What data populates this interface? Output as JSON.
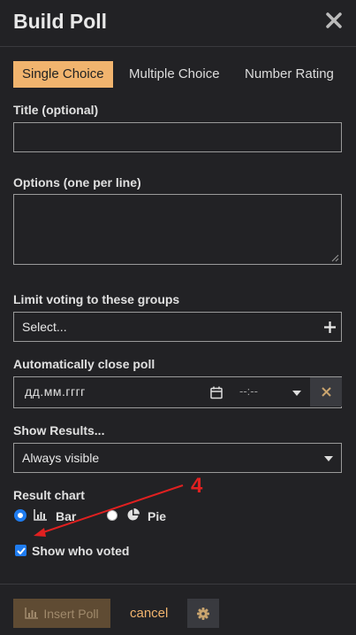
{
  "header": {
    "title": "Build Poll"
  },
  "tabs": [
    "Single Choice",
    "Multiple Choice",
    "Number Rating"
  ],
  "title_field": {
    "label": "Title (optional)",
    "value": ""
  },
  "options_field": {
    "label": "Options (one per line)",
    "value": ""
  },
  "groups_field": {
    "label": "Limit voting to these groups",
    "value": "Select..."
  },
  "close_field": {
    "label": "Automatically close poll",
    "date": "дд.мм.гггг",
    "time": "--:--"
  },
  "results_field": {
    "label": "Show Results...",
    "value": "Always visible"
  },
  "chart_field": {
    "label": "Result chart",
    "options": [
      "Bar",
      "Pie"
    ],
    "selected": "Bar"
  },
  "show_voters": {
    "label": "Show who voted",
    "checked": true
  },
  "footer": {
    "insert_label": "Insert Poll",
    "cancel_label": "cancel"
  },
  "annotation": {
    "number": "4"
  },
  "colors": {
    "accent": "#f1b46e",
    "annotation": "#e02020",
    "radio": "#1f7cf0"
  },
  "icons": [
    "close-icon",
    "plus-icon",
    "calendar-icon",
    "chevron-down-icon",
    "clear-x-icon",
    "bar-chart-icon",
    "pie-chart-icon",
    "check-icon",
    "gear-icon"
  ]
}
